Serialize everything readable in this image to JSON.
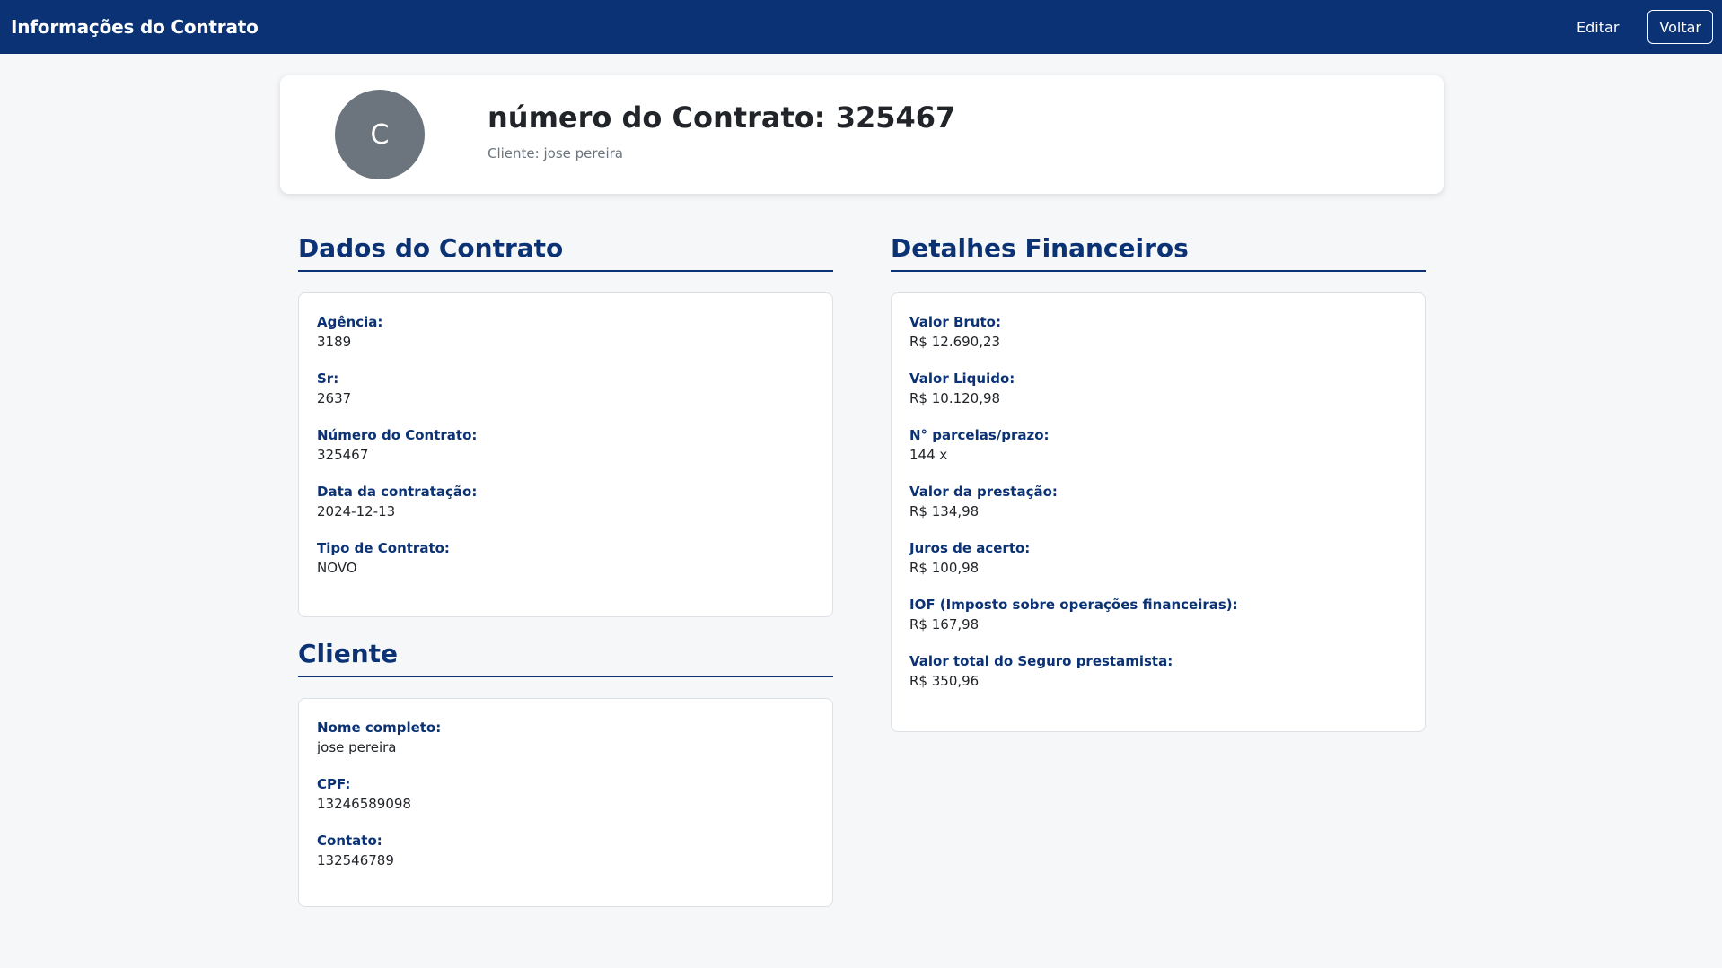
{
  "navbar": {
    "title": "Informações do Contrato",
    "edit_label": "Editar",
    "back_label": "Voltar"
  },
  "header": {
    "avatar_letter": "C",
    "title": "número do Contrato: 325467",
    "subtitle": "Cliente: jose pereira"
  },
  "contract_section": {
    "title": "Dados do Contrato",
    "fields": [
      {
        "label": "Agência:",
        "value": "3189"
      },
      {
        "label": "Sr:",
        "value": "2637"
      },
      {
        "label": "Número do Contrato:",
        "value": "325467"
      },
      {
        "label": "Data da contratação:",
        "value": "2024-12-13"
      },
      {
        "label": "Tipo de Contrato:",
        "value": "NOVO"
      }
    ]
  },
  "client_section": {
    "title": "Cliente",
    "fields": [
      {
        "label": "Nome completo:",
        "value": "jose pereira"
      },
      {
        "label": "CPF:",
        "value": "13246589098"
      },
      {
        "label": "Contato:",
        "value": "132546789"
      }
    ]
  },
  "financial_section": {
    "title": "Detalhes Financeiros",
    "fields": [
      {
        "label": "Valor Bruto:",
        "value": "R$ 12.690,23"
      },
      {
        "label": "Valor Liquido:",
        "value": "R$ 10.120,98"
      },
      {
        "label": "N° parcelas/prazo:",
        "value": "144 x"
      },
      {
        "label": "Valor da prestação:",
        "value": "R$ 134,98"
      },
      {
        "label": "Juros de acerto:",
        "value": "R$ 100,98"
      },
      {
        "label": "IOF (Imposto sobre operações financeiras):",
        "value": "R$ 167,98"
      },
      {
        "label": "Valor total do Seguro prestamista:",
        "value": "R$ 350,96"
      }
    ]
  },
  "colors": {
    "primary": "#0b3274",
    "avatar": "#6c757d",
    "background": "#f6f7f9"
  }
}
